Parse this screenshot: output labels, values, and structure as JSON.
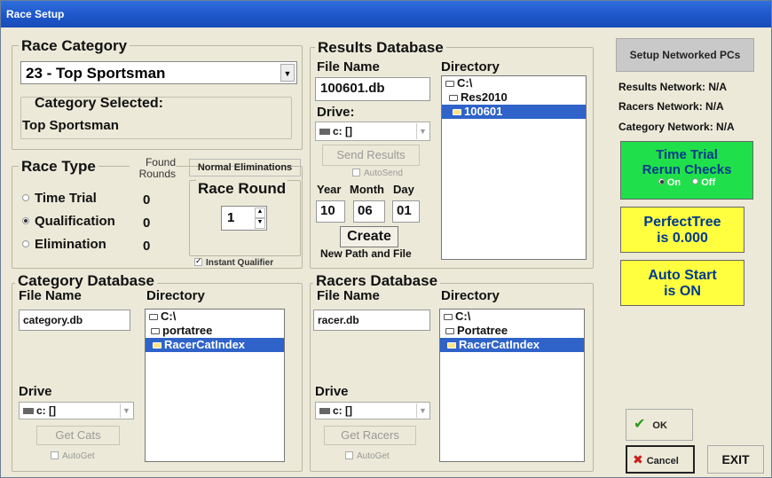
{
  "window": {
    "title": "Race Setup"
  },
  "race_category": {
    "legend": "Race Category",
    "selected_value": "23 - Top Sportsman",
    "category_selected_label": "Category Selected:",
    "category_selected_value": "Top Sportsman"
  },
  "race_type": {
    "legend": "Race Type",
    "found_rounds_label": "Found Rounds",
    "options": [
      {
        "label": "Time Trial",
        "count": "0",
        "selected": false
      },
      {
        "label": "Qualification",
        "count": "0",
        "selected": true
      },
      {
        "label": "Elimination",
        "count": "0",
        "selected": false
      }
    ],
    "normal_eliminations_label": "Normal Eliminations",
    "race_round_label": "Race Round",
    "race_round_value": "1",
    "instant_qualifier_label": "Instant Qualifier",
    "instant_qualifier_checked": true
  },
  "results_database": {
    "legend": "Results Database",
    "file_name_label": "File Name",
    "file_name_value": "100601.db",
    "directory_label": "Directory",
    "directory_items": [
      "C:\\",
      "Res2010",
      "100601"
    ],
    "drive_label": "Drive:",
    "drive_value": "c: []",
    "send_results_label": "Send Results",
    "autosend_label": "AutoSend",
    "year_label": "Year",
    "month_label": "Month",
    "day_label": "Day",
    "year_value": "10",
    "month_value": "06",
    "day_value": "01",
    "create_label": "Create",
    "new_path_label": "New Path and File"
  },
  "category_database": {
    "legend": "Category Database",
    "file_name_label": "File Name",
    "file_name_value": "category.db",
    "directory_label": "Directory",
    "directory_items": [
      "C:\\",
      "portatree",
      "RacerCatIndex"
    ],
    "drive_label": "Drive",
    "drive_value": "c: []",
    "get_button_label": "Get Cats",
    "autoget_label": "AutoGet"
  },
  "racers_database": {
    "legend": "Racers Database",
    "file_name_label": "File Name",
    "file_name_value": "racer.db",
    "directory_label": "Directory",
    "directory_items": [
      "C:\\",
      "Portatree",
      "RacerCatIndex"
    ],
    "drive_label": "Drive",
    "drive_value": "c: []",
    "get_button_label": "Get Racers",
    "autoget_label": "AutoGet"
  },
  "network": {
    "setup_button_label": "Setup Networked PCs",
    "results_network": "Results Network:  N/A",
    "racers_network": "Racers Network:  N/A",
    "category_network": "Category Network:  N/A"
  },
  "time_trial_panel": {
    "title_line1": "Time Trial",
    "title_line2": "Rerun Checks",
    "on_label": "On",
    "off_label": "Off",
    "color": "#1fe04a"
  },
  "perfect_tree_panel": {
    "line1": "PerfectTree",
    "line2": "is 0.000",
    "color": "#ffff40"
  },
  "auto_start_panel": {
    "line1": "Auto Start",
    "line2": "is ON",
    "color": "#ffff40"
  },
  "buttons": {
    "ok_label": "OK",
    "cancel_label": "Cancel",
    "exit_label": "EXIT"
  }
}
